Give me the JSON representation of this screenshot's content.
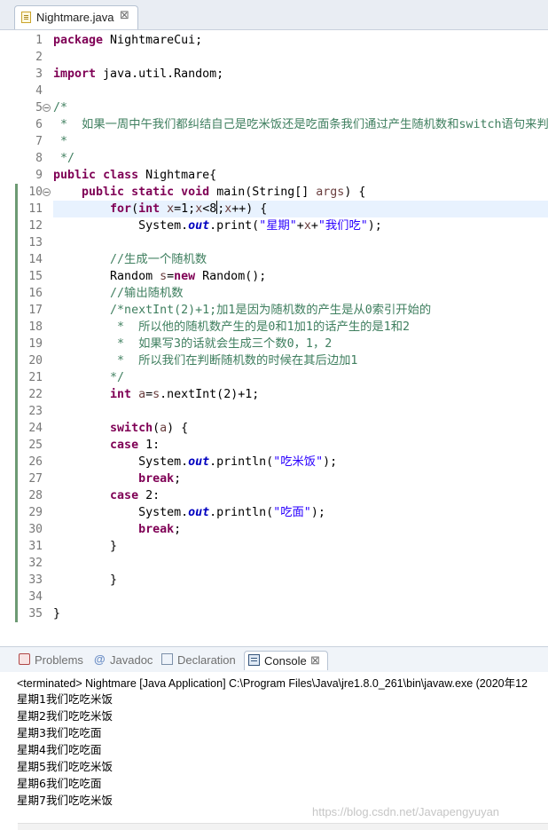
{
  "editor": {
    "tab_label": "Nightmare.java",
    "tab_close": "⊠",
    "lines": [
      [
        {
          "t": "package",
          "c": "kw"
        },
        {
          "t": " NightmareCui;"
        }
      ],
      [],
      [
        {
          "t": "import",
          "c": "kw"
        },
        {
          "t": " java.util.Random;"
        }
      ],
      [],
      [
        {
          "t": "/*",
          "c": "cm"
        }
      ],
      [
        {
          "t": " *  如果一周中午我们都纠结自己是吃米饭还是吃面条我们通过产生随机数和switch语句来判断",
          "c": "cm"
        }
      ],
      [
        {
          "t": " *",
          "c": "cm"
        }
      ],
      [
        {
          "t": " */",
          "c": "cm"
        }
      ],
      [
        {
          "t": "public",
          "c": "kw"
        },
        {
          "t": " "
        },
        {
          "t": "class",
          "c": "kw"
        },
        {
          "t": " Nightmare{"
        }
      ],
      [
        {
          "t": "    "
        },
        {
          "t": "public",
          "c": "kw"
        },
        {
          "t": " "
        },
        {
          "t": "static",
          "c": "kw"
        },
        {
          "t": " "
        },
        {
          "t": "void",
          "c": "kw"
        },
        {
          "t": " main(String[] "
        },
        {
          "t": "args",
          "c": "loc"
        },
        {
          "t": ") {"
        }
      ],
      [
        {
          "t": "        "
        },
        {
          "t": "for",
          "c": "kw"
        },
        {
          "t": "("
        },
        {
          "t": "int",
          "c": "kw"
        },
        {
          "t": " "
        },
        {
          "t": "x",
          "c": "loc"
        },
        {
          "t": "=1;"
        },
        {
          "t": "x",
          "c": "loc"
        },
        {
          "t": "<8"
        },
        {
          "caret": true
        },
        {
          "t": ";"
        },
        {
          "t": "x",
          "c": "loc"
        },
        {
          "t": "++) {"
        }
      ],
      [
        {
          "t": "            System."
        },
        {
          "t": "out",
          "c": "fld"
        },
        {
          "t": ".print("
        },
        {
          "t": "\"星期\"",
          "c": "str"
        },
        {
          "t": "+"
        },
        {
          "t": "x",
          "c": "loc"
        },
        {
          "t": "+"
        },
        {
          "t": "\"我们吃\"",
          "c": "str"
        },
        {
          "t": ");"
        }
      ],
      [],
      [
        {
          "t": "        "
        },
        {
          "t": "//生成一个随机数",
          "c": "cm"
        }
      ],
      [
        {
          "t": "        Random "
        },
        {
          "t": "s",
          "c": "loc"
        },
        {
          "t": "="
        },
        {
          "t": "new",
          "c": "kw"
        },
        {
          "t": " Random();"
        }
      ],
      [
        {
          "t": "        "
        },
        {
          "t": "//输出随机数",
          "c": "cm"
        }
      ],
      [
        {
          "t": "        "
        },
        {
          "t": "/*nextInt(2)+1;加1是因为随机数的产生是从0索引开始的",
          "c": "cm"
        }
      ],
      [
        {
          "t": "         *  所以他的随机数产生的是0和1加1的话产生的是1和2",
          "c": "cm"
        }
      ],
      [
        {
          "t": "         *  如果写3的话就会生成三个数0，1，2",
          "c": "cm"
        }
      ],
      [
        {
          "t": "         *  所以我们在判断随机数的时候在其后边加1",
          "c": "cm"
        }
      ],
      [
        {
          "t": "        */",
          "c": "cm"
        }
      ],
      [
        {
          "t": "        "
        },
        {
          "t": "int",
          "c": "kw"
        },
        {
          "t": " "
        },
        {
          "t": "a",
          "c": "loc"
        },
        {
          "t": "="
        },
        {
          "t": "s",
          "c": "loc"
        },
        {
          "t": ".nextInt(2)+1;"
        }
      ],
      [],
      [
        {
          "t": "        "
        },
        {
          "t": "switch",
          "c": "kw"
        },
        {
          "t": "("
        },
        {
          "t": "a",
          "c": "loc"
        },
        {
          "t": ") {"
        }
      ],
      [
        {
          "t": "        "
        },
        {
          "t": "case",
          "c": "kw"
        },
        {
          "t": " 1:"
        }
      ],
      [
        {
          "t": "            System."
        },
        {
          "t": "out",
          "c": "fld"
        },
        {
          "t": ".println("
        },
        {
          "t": "\"吃米饭\"",
          "c": "str"
        },
        {
          "t": ");"
        }
      ],
      [
        {
          "t": "            "
        },
        {
          "t": "break",
          "c": "kw"
        },
        {
          "t": ";"
        }
      ],
      [
        {
          "t": "        "
        },
        {
          "t": "case",
          "c": "kw"
        },
        {
          "t": " 2:"
        }
      ],
      [
        {
          "t": "            System."
        },
        {
          "t": "out",
          "c": "fld"
        },
        {
          "t": ".println("
        },
        {
          "t": "\"吃面\"",
          "c": "str"
        },
        {
          "t": ");"
        }
      ],
      [
        {
          "t": "            "
        },
        {
          "t": "break",
          "c": "kw"
        },
        {
          "t": ";"
        }
      ],
      [
        {
          "t": "        }"
        }
      ],
      [],
      [
        {
          "t": "        }"
        }
      ],
      [],
      [
        {
          "t": "}"
        }
      ]
    ],
    "current_line": 11,
    "fold_lines": [
      5,
      10
    ],
    "scroll_arrow": "‹"
  },
  "panel": {
    "tabs": [
      {
        "label": "Problems",
        "icon": "problems-icon",
        "active": false
      },
      {
        "label": "Javadoc",
        "icon": "javadoc-icon",
        "icon_glyph": "@",
        "active": false
      },
      {
        "label": "Declaration",
        "icon": "declaration-icon",
        "active": false
      },
      {
        "label": "Console",
        "icon": "console-icon",
        "active": true,
        "close": "⊠"
      }
    ]
  },
  "console": {
    "header": "<terminated> Nightmare [Java Application] C:\\Program Files\\Java\\jre1.8.0_261\\bin\\javaw.exe (2020年12",
    "output": [
      "星期1我们吃吃米饭",
      "星期2我们吃吃米饭",
      "星期3我们吃吃面",
      "星期4我们吃吃面",
      "星期5我们吃吃米饭",
      "星期6我们吃吃面",
      "星期7我们吃吃米饭"
    ],
    "watermark": "https://blog.csdn.net/Javapengyuyan"
  },
  "colors": {
    "keyword": "#7f0055",
    "comment": "#3f7f5f",
    "string": "#2a00ff",
    "static_field": "#0000c0",
    "local_var": "#6a3e3e",
    "current_line": "#e8f2fe"
  }
}
